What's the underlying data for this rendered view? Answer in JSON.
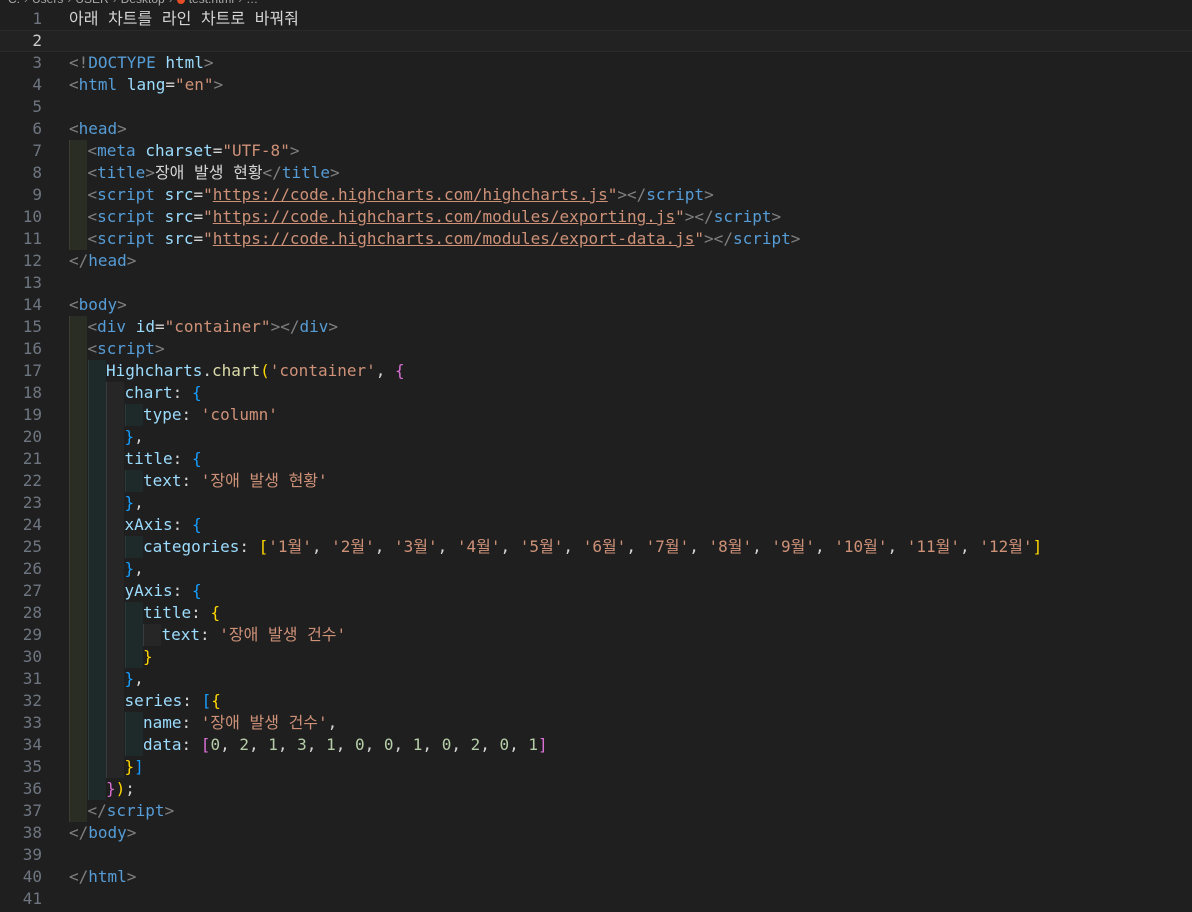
{
  "breadcrumb": [
    "C:",
    "Users",
    "USER",
    "Desktop",
    "test.html",
    "…"
  ],
  "editor": {
    "current_line": 2,
    "lines": [
      {
        "n": "1",
        "indent": 0,
        "tokens": [
          [
            "t-ko",
            "아래 차트를 라인 차트로 바꿔줘"
          ]
        ]
      },
      {
        "n": "2",
        "indent": 0,
        "tokens": []
      },
      {
        "n": "3",
        "indent": 0,
        "tokens": [
          [
            "t-br",
            "<!"
          ],
          [
            "t-tag",
            "DOCTYPE"
          ],
          [
            "t-plain",
            " "
          ],
          [
            "t-attr",
            "html"
          ],
          [
            "t-br",
            ">"
          ]
        ]
      },
      {
        "n": "4",
        "indent": 0,
        "tokens": [
          [
            "t-br",
            "<"
          ],
          [
            "t-tag",
            "html"
          ],
          [
            "t-plain",
            " "
          ],
          [
            "t-attr",
            "lang"
          ],
          [
            "t-plain",
            "="
          ],
          [
            "t-str",
            "\"en\""
          ],
          [
            "t-br",
            ">"
          ]
        ]
      },
      {
        "n": "5",
        "indent": 0,
        "tokens": []
      },
      {
        "n": "6",
        "indent": 0,
        "tokens": [
          [
            "t-br",
            "<"
          ],
          [
            "t-tag",
            "head"
          ],
          [
            "t-br",
            ">"
          ]
        ]
      },
      {
        "n": "7",
        "indent": 1,
        "tokens": [
          [
            "t-br",
            "<"
          ],
          [
            "t-tag",
            "meta"
          ],
          [
            "t-plain",
            " "
          ],
          [
            "t-attr",
            "charset"
          ],
          [
            "t-plain",
            "="
          ],
          [
            "t-str",
            "\"UTF-8\""
          ],
          [
            "t-br",
            ">"
          ]
        ]
      },
      {
        "n": "8",
        "indent": 1,
        "tokens": [
          [
            "t-br",
            "<"
          ],
          [
            "t-tag",
            "title"
          ],
          [
            "t-br",
            ">"
          ],
          [
            "t-plain",
            "장애 발생 현황"
          ],
          [
            "t-br",
            "</"
          ],
          [
            "t-tag",
            "title"
          ],
          [
            "t-br",
            ">"
          ]
        ]
      },
      {
        "n": "9",
        "indent": 1,
        "tokens": [
          [
            "t-br",
            "<"
          ],
          [
            "t-tag",
            "script"
          ],
          [
            "t-plain",
            " "
          ],
          [
            "t-attr",
            "src"
          ],
          [
            "t-plain",
            "="
          ],
          [
            "t-str",
            "\""
          ],
          [
            "t-url",
            "https://code.highcharts.com/highcharts.js"
          ],
          [
            "t-str",
            "\""
          ],
          [
            "t-br",
            "></"
          ],
          [
            "t-tag",
            "script"
          ],
          [
            "t-br",
            ">"
          ]
        ]
      },
      {
        "n": "10",
        "indent": 1,
        "tokens": [
          [
            "t-br",
            "<"
          ],
          [
            "t-tag",
            "script"
          ],
          [
            "t-plain",
            " "
          ],
          [
            "t-attr",
            "src"
          ],
          [
            "t-plain",
            "="
          ],
          [
            "t-str",
            "\""
          ],
          [
            "t-url",
            "https://code.highcharts.com/modules/exporting.js"
          ],
          [
            "t-str",
            "\""
          ],
          [
            "t-br",
            "></"
          ],
          [
            "t-tag",
            "script"
          ],
          [
            "t-br",
            ">"
          ]
        ]
      },
      {
        "n": "11",
        "indent": 1,
        "tokens": [
          [
            "t-br",
            "<"
          ],
          [
            "t-tag",
            "script"
          ],
          [
            "t-plain",
            " "
          ],
          [
            "t-attr",
            "src"
          ],
          [
            "t-plain",
            "="
          ],
          [
            "t-str",
            "\""
          ],
          [
            "t-url",
            "https://code.highcharts.com/modules/export-data.js"
          ],
          [
            "t-str",
            "\""
          ],
          [
            "t-br",
            "></"
          ],
          [
            "t-tag",
            "script"
          ],
          [
            "t-br",
            ">"
          ]
        ]
      },
      {
        "n": "12",
        "indent": 0,
        "tokens": [
          [
            "t-br",
            "</"
          ],
          [
            "t-tag",
            "head"
          ],
          [
            "t-br",
            ">"
          ]
        ]
      },
      {
        "n": "13",
        "indent": 0,
        "tokens": []
      },
      {
        "n": "14",
        "indent": 0,
        "tokens": [
          [
            "t-br",
            "<"
          ],
          [
            "t-tag",
            "body"
          ],
          [
            "t-br",
            ">"
          ]
        ]
      },
      {
        "n": "15",
        "indent": 1,
        "tokens": [
          [
            "t-br",
            "<"
          ],
          [
            "t-tag",
            "div"
          ],
          [
            "t-plain",
            " "
          ],
          [
            "t-attr",
            "id"
          ],
          [
            "t-plain",
            "="
          ],
          [
            "t-str",
            "\"container\""
          ],
          [
            "t-br",
            "></"
          ],
          [
            "t-tag",
            "div"
          ],
          [
            "t-br",
            ">"
          ]
        ]
      },
      {
        "n": "16",
        "indent": 1,
        "tokens": [
          [
            "t-br",
            "<"
          ],
          [
            "t-tag",
            "script"
          ],
          [
            "t-br",
            ">"
          ]
        ]
      },
      {
        "n": "17",
        "indent": 2,
        "tokens": [
          [
            "t-var",
            "Highcharts"
          ],
          [
            "t-plain",
            "."
          ],
          [
            "t-fn",
            "chart"
          ],
          [
            "t-p1",
            "("
          ],
          [
            "t-str",
            "'container'"
          ],
          [
            "t-plain",
            ", "
          ],
          [
            "t-p2",
            "{"
          ]
        ]
      },
      {
        "n": "18",
        "indent": 3,
        "tokens": [
          [
            "t-var",
            "chart"
          ],
          [
            "t-plain",
            ": "
          ],
          [
            "t-p3",
            "{"
          ]
        ]
      },
      {
        "n": "19",
        "indent": 4,
        "tokens": [
          [
            "t-var",
            "type"
          ],
          [
            "t-plain",
            ": "
          ],
          [
            "t-str",
            "'column'"
          ]
        ]
      },
      {
        "n": "20",
        "indent": 3,
        "tokens": [
          [
            "t-p3",
            "}"
          ],
          [
            "t-plain",
            ","
          ]
        ]
      },
      {
        "n": "21",
        "indent": 3,
        "tokens": [
          [
            "t-var",
            "title"
          ],
          [
            "t-plain",
            ": "
          ],
          [
            "t-p3",
            "{"
          ]
        ]
      },
      {
        "n": "22",
        "indent": 4,
        "tokens": [
          [
            "t-var",
            "text"
          ],
          [
            "t-plain",
            ": "
          ],
          [
            "t-str",
            "'장애 발생 현황'"
          ]
        ]
      },
      {
        "n": "23",
        "indent": 3,
        "tokens": [
          [
            "t-p3",
            "}"
          ],
          [
            "t-plain",
            ","
          ]
        ]
      },
      {
        "n": "24",
        "indent": 3,
        "tokens": [
          [
            "t-var",
            "xAxis"
          ],
          [
            "t-plain",
            ": "
          ],
          [
            "t-p3",
            "{"
          ]
        ]
      },
      {
        "n": "25",
        "indent": 4,
        "tokens": [
          [
            "t-var",
            "categories"
          ],
          [
            "t-plain",
            ": "
          ],
          [
            "t-p1",
            "["
          ],
          [
            "t-str",
            "'1월'"
          ],
          [
            "t-plain",
            ", "
          ],
          [
            "t-str",
            "'2월'"
          ],
          [
            "t-plain",
            ", "
          ],
          [
            "t-str",
            "'3월'"
          ],
          [
            "t-plain",
            ", "
          ],
          [
            "t-str",
            "'4월'"
          ],
          [
            "t-plain",
            ", "
          ],
          [
            "t-str",
            "'5월'"
          ],
          [
            "t-plain",
            ", "
          ],
          [
            "t-str",
            "'6월'"
          ],
          [
            "t-plain",
            ", "
          ],
          [
            "t-str",
            "'7월'"
          ],
          [
            "t-plain",
            ", "
          ],
          [
            "t-str",
            "'8월'"
          ],
          [
            "t-plain",
            ", "
          ],
          [
            "t-str",
            "'9월'"
          ],
          [
            "t-plain",
            ", "
          ],
          [
            "t-str",
            "'10월'"
          ],
          [
            "t-plain",
            ", "
          ],
          [
            "t-str",
            "'11월'"
          ],
          [
            "t-plain",
            ", "
          ],
          [
            "t-str",
            "'12월'"
          ],
          [
            "t-p1",
            "]"
          ]
        ]
      },
      {
        "n": "26",
        "indent": 3,
        "tokens": [
          [
            "t-p3",
            "}"
          ],
          [
            "t-plain",
            ","
          ]
        ]
      },
      {
        "n": "27",
        "indent": 3,
        "tokens": [
          [
            "t-var",
            "yAxis"
          ],
          [
            "t-plain",
            ": "
          ],
          [
            "t-p3",
            "{"
          ]
        ]
      },
      {
        "n": "28",
        "indent": 4,
        "tokens": [
          [
            "t-var",
            "title"
          ],
          [
            "t-plain",
            ": "
          ],
          [
            "t-p1",
            "{"
          ]
        ]
      },
      {
        "n": "29",
        "indent": 5,
        "tokens": [
          [
            "t-var",
            "text"
          ],
          [
            "t-plain",
            ": "
          ],
          [
            "t-str",
            "'장애 발생 건수'"
          ]
        ]
      },
      {
        "n": "30",
        "indent": 4,
        "tokens": [
          [
            "t-p1",
            "}"
          ]
        ]
      },
      {
        "n": "31",
        "indent": 3,
        "tokens": [
          [
            "t-p3",
            "}"
          ],
          [
            "t-plain",
            ","
          ]
        ]
      },
      {
        "n": "32",
        "indent": 3,
        "tokens": [
          [
            "t-var",
            "series"
          ],
          [
            "t-plain",
            ": "
          ],
          [
            "t-p3",
            "["
          ],
          [
            "t-p1",
            "{"
          ]
        ]
      },
      {
        "n": "33",
        "indent": 4,
        "tokens": [
          [
            "t-var",
            "name"
          ],
          [
            "t-plain",
            ": "
          ],
          [
            "t-str",
            "'장애 발생 건수'"
          ],
          [
            "t-plain",
            ","
          ]
        ]
      },
      {
        "n": "34",
        "indent": 4,
        "tokens": [
          [
            "t-var",
            "data"
          ],
          [
            "t-plain",
            ": "
          ],
          [
            "t-p2",
            "["
          ],
          [
            "t-num",
            "0"
          ],
          [
            "t-plain",
            ", "
          ],
          [
            "t-num",
            "2"
          ],
          [
            "t-plain",
            ", "
          ],
          [
            "t-num",
            "1"
          ],
          [
            "t-plain",
            ", "
          ],
          [
            "t-num",
            "3"
          ],
          [
            "t-plain",
            ", "
          ],
          [
            "t-num",
            "1"
          ],
          [
            "t-plain",
            ", "
          ],
          [
            "t-num",
            "0"
          ],
          [
            "t-plain",
            ", "
          ],
          [
            "t-num",
            "0"
          ],
          [
            "t-plain",
            ", "
          ],
          [
            "t-num",
            "1"
          ],
          [
            "t-plain",
            ", "
          ],
          [
            "t-num",
            "0"
          ],
          [
            "t-plain",
            ", "
          ],
          [
            "t-num",
            "2"
          ],
          [
            "t-plain",
            ", "
          ],
          [
            "t-num",
            "0"
          ],
          [
            "t-plain",
            ", "
          ],
          [
            "t-num",
            "1"
          ],
          [
            "t-p2",
            "]"
          ]
        ]
      },
      {
        "n": "35",
        "indent": 3,
        "tokens": [
          [
            "t-p1",
            "}"
          ],
          [
            "t-p3",
            "]"
          ]
        ]
      },
      {
        "n": "36",
        "indent": 2,
        "tokens": [
          [
            "t-p2",
            "}"
          ],
          [
            "t-p1",
            ")"
          ],
          [
            "t-plain",
            ";"
          ]
        ]
      },
      {
        "n": "37",
        "indent": 1,
        "tokens": [
          [
            "t-br",
            "</"
          ],
          [
            "t-tag",
            "script"
          ],
          [
            "t-br",
            ">"
          ]
        ]
      },
      {
        "n": "38",
        "indent": 0,
        "tokens": [
          [
            "t-br",
            "</"
          ],
          [
            "t-tag",
            "body"
          ],
          [
            "t-br",
            ">"
          ]
        ]
      },
      {
        "n": "39",
        "indent": 0,
        "tokens": []
      },
      {
        "n": "40",
        "indent": 0,
        "tokens": [
          [
            "t-br",
            "</"
          ],
          [
            "t-tag",
            "html"
          ],
          [
            "t-br",
            ">"
          ]
        ]
      },
      {
        "n": "41",
        "indent": 0,
        "tokens": []
      }
    ]
  }
}
